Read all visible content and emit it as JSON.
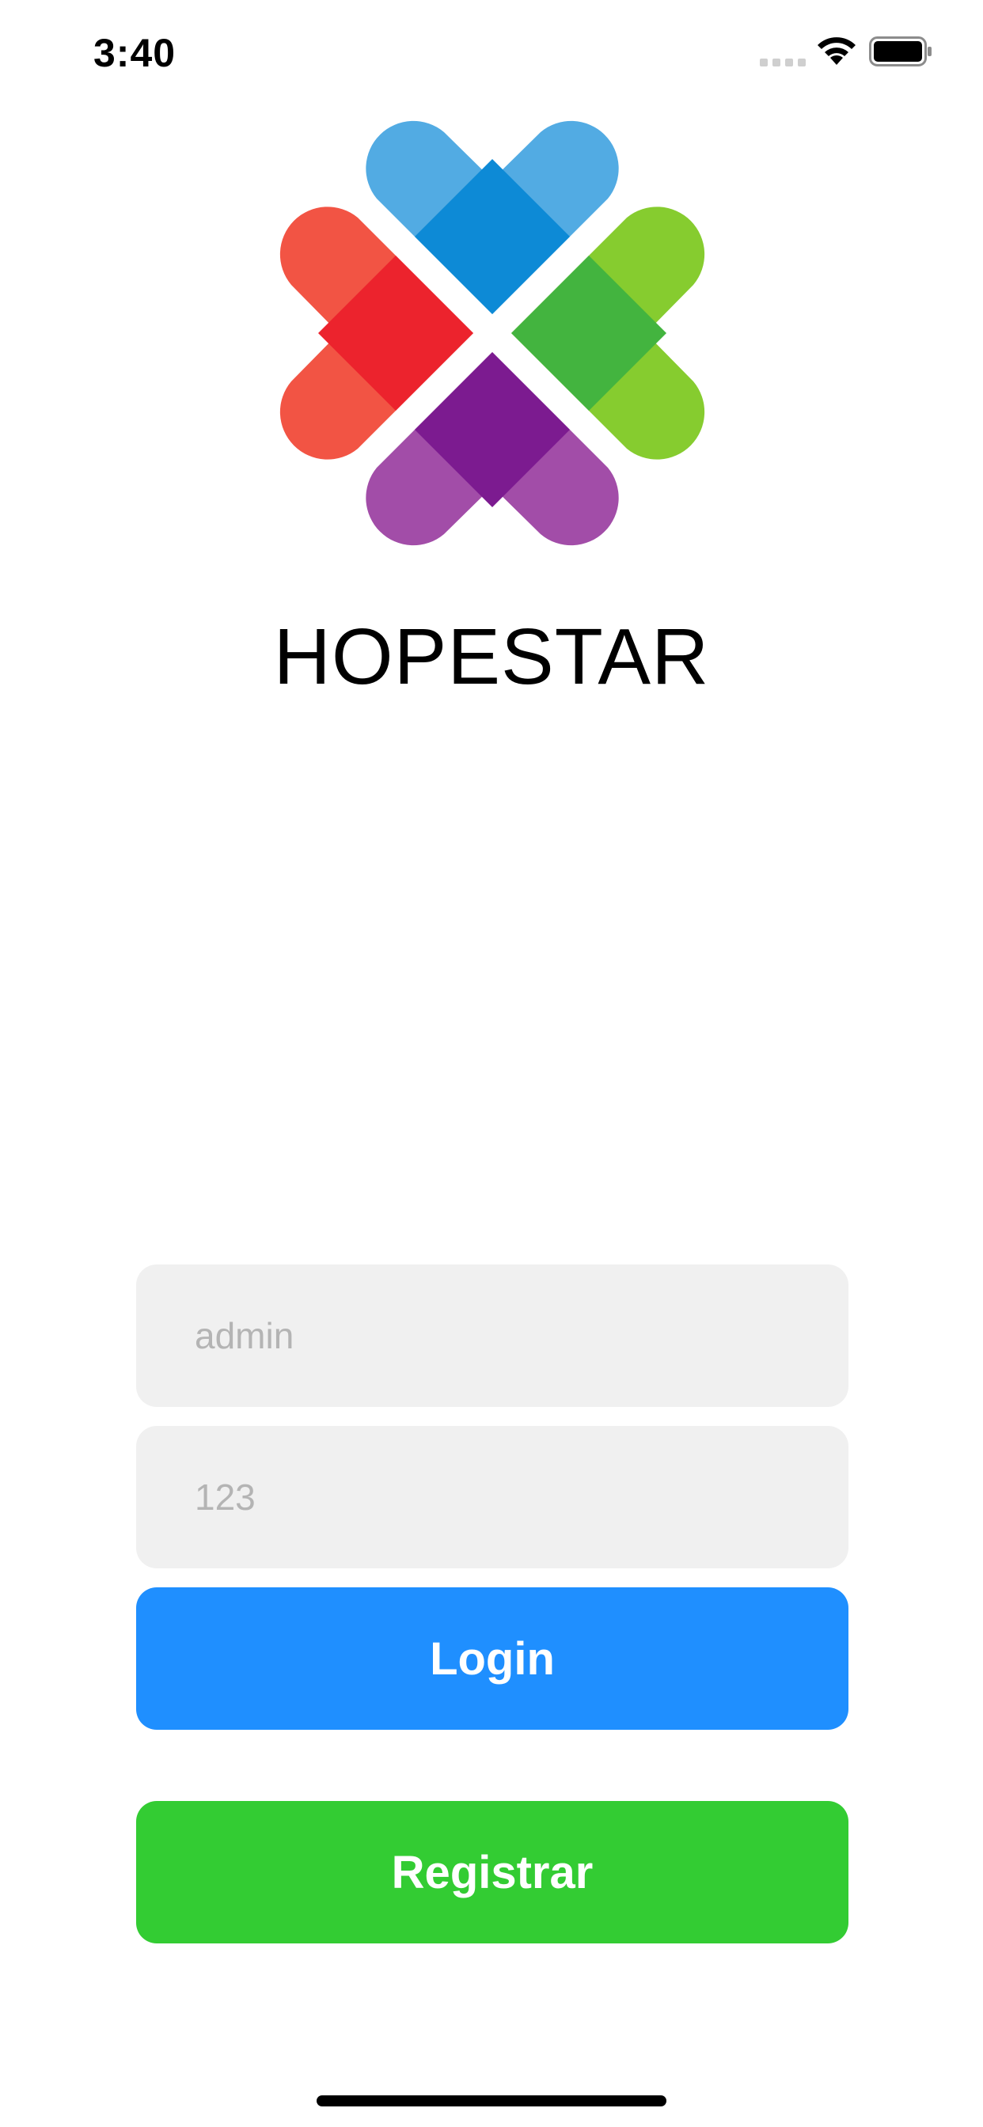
{
  "status_bar": {
    "time": "3:40",
    "icons": [
      "signal-dots-icon",
      "wifi-icon",
      "battery-icon"
    ]
  },
  "brand": {
    "name": "HOPESTAR",
    "logo_icon": "four-heart-clover-logo",
    "logo_colors": {
      "blue": "#52abe3",
      "blue_dark": "#0d8ad6",
      "red": "#f25444",
      "red_dark": "#ec232d",
      "green": "#86cc2f",
      "green_dark": "#43b43f",
      "purple": "#a24da8",
      "purple_dark": "#7c1b90"
    }
  },
  "login_form": {
    "username_placeholder": "admin",
    "password_placeholder": "123",
    "login_label": "Login",
    "register_label": "Registrar"
  },
  "colors": {
    "field_bg": "#f0f0f0",
    "placeholder": "#b4b4b4",
    "login_button": "#1f8fff",
    "register_button": "#33cc33"
  }
}
